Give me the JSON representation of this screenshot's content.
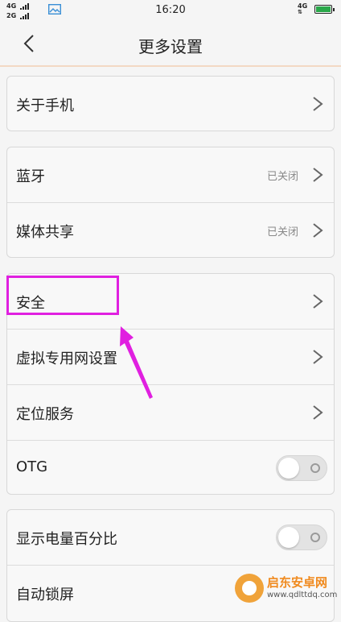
{
  "status_bar": {
    "network_top": "4G",
    "network_bottom": "2G",
    "time": "16:20",
    "data_network": "4G",
    "icons": [
      "signal-icon",
      "gallery-icon",
      "battery-icon"
    ]
  },
  "header": {
    "title": "更多设置"
  },
  "groups": [
    {
      "rows": [
        {
          "label": "关于手机",
          "control": "chevron"
        }
      ]
    },
    {
      "rows": [
        {
          "label": "蓝牙",
          "status": "已关闭",
          "control": "chevron"
        },
        {
          "label": "媒体共享",
          "status": "已关闭",
          "control": "chevron"
        }
      ]
    },
    {
      "rows": [
        {
          "label": "安全",
          "control": "chevron"
        },
        {
          "label": "虚拟专用网设置",
          "control": "chevron"
        },
        {
          "label": "定位服务",
          "control": "chevron"
        },
        {
          "label": "OTG",
          "control": "toggle",
          "on": false
        }
      ]
    },
    {
      "rows": [
        {
          "label": "显示电量百分比",
          "control": "toggle",
          "on": false
        },
        {
          "label": "自动锁屏"
        }
      ]
    }
  ],
  "annotation": {
    "highlight_color": "#e020e0",
    "highlighted_item": "安全"
  },
  "watermark": {
    "name": "启东安卓网",
    "url": "www.qdlttdq.com"
  },
  "colors": {
    "accent_line": "#f3d9c4",
    "battery": "#2aa84a"
  }
}
